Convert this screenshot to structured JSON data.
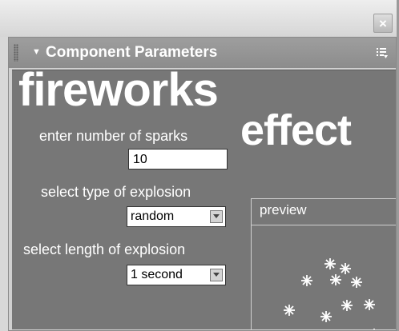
{
  "window": {
    "close_glyph": "×"
  },
  "panel": {
    "title": "Component Parameters",
    "collapse_icon": "triangle-down-icon",
    "options_icon": "panel-options-icon"
  },
  "component": {
    "title_line1": "fireworks",
    "title_line2": "effect",
    "sparks_label": "enter number of sparks",
    "sparks_value": "10",
    "explosion_type_label": "select type of explosion",
    "explosion_type_value": "random",
    "explosion_length_label": "select length of explosion",
    "explosion_length_value": "1 second"
  },
  "preview": {
    "label": "preview",
    "spark_icon": "spark-icon"
  },
  "colors": {
    "content_bg": "#777777",
    "text": "#ffffff",
    "header_bg": "#959595"
  }
}
